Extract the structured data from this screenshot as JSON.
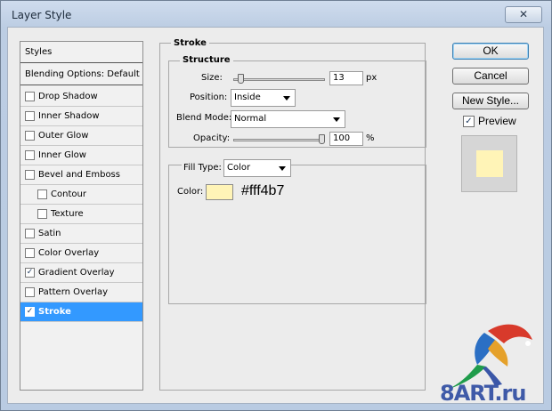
{
  "window": {
    "title": "Layer Style",
    "close_label": "✕"
  },
  "styles_list": {
    "header": "Styles",
    "blending_label": "Blending Options: Default",
    "items": [
      {
        "label": "Drop Shadow",
        "checked": false,
        "indent": false,
        "selected": false
      },
      {
        "label": "Inner Shadow",
        "checked": false,
        "indent": false,
        "selected": false
      },
      {
        "label": "Outer Glow",
        "checked": false,
        "indent": false,
        "selected": false
      },
      {
        "label": "Inner Glow",
        "checked": false,
        "indent": false,
        "selected": false
      },
      {
        "label": "Bevel and Emboss",
        "checked": false,
        "indent": false,
        "selected": false
      },
      {
        "label": "Contour",
        "checked": false,
        "indent": true,
        "selected": false
      },
      {
        "label": "Texture",
        "checked": false,
        "indent": true,
        "selected": false
      },
      {
        "label": "Satin",
        "checked": false,
        "indent": false,
        "selected": false
      },
      {
        "label": "Color Overlay",
        "checked": false,
        "indent": false,
        "selected": false
      },
      {
        "label": "Gradient Overlay",
        "checked": true,
        "indent": false,
        "selected": false
      },
      {
        "label": "Pattern Overlay",
        "checked": false,
        "indent": false,
        "selected": false
      },
      {
        "label": "Stroke",
        "checked": true,
        "indent": false,
        "selected": true
      }
    ]
  },
  "stroke": {
    "title": "Stroke",
    "structure_title": "Structure",
    "size_label": "Size:",
    "size_value": "13",
    "size_unit": "px",
    "size_level": 0.05,
    "position_label": "Position:",
    "position_value": "Inside",
    "blend_mode_label": "Blend Mode:",
    "blend_mode_value": "Normal",
    "opacity_label": "Opacity:",
    "opacity_value": "100",
    "opacity_unit": "%",
    "opacity_level": 1.0,
    "fill_type_label": "Fill Type:",
    "fill_type_value": "Color",
    "color_label": "Color:",
    "color_hex_text": "#fff4b7",
    "color_swatch": "#fff4b7"
  },
  "buttons": {
    "ok": "OK",
    "cancel": "Cancel",
    "new_style": "New Style...",
    "preview_label": "Preview",
    "preview_checked": true,
    "check_mark": "✓"
  },
  "watermark": {
    "text": "8ART.ru",
    "icon": "parrot-logo"
  }
}
